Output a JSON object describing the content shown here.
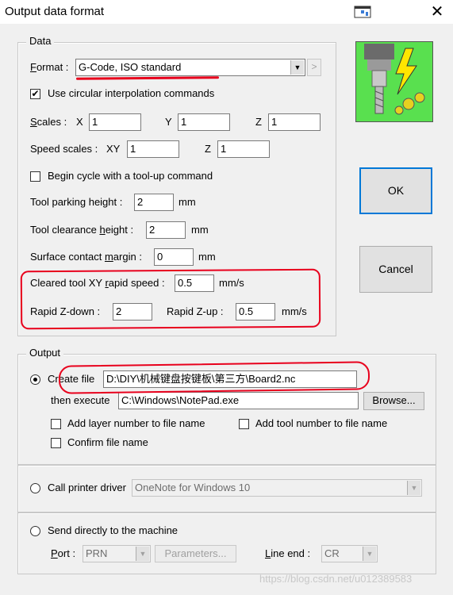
{
  "window": {
    "title": "Output data format",
    "close_glyph": "✕"
  },
  "data_group": {
    "legend": "Data",
    "format_label": "Format :",
    "format_value": "G-Code, ISO standard",
    "format_side_btn": ">",
    "circular_label": "Use circular interpolation commands",
    "circular_checked": true,
    "scales_label": "Scales :",
    "scale_x_label": "X",
    "scale_x": "1",
    "scale_y_label": "Y",
    "scale_y": "1",
    "scale_z_label": "Z",
    "scale_z": "1",
    "speed_scales_label": "Speed scales :",
    "speed_xy_label": "XY",
    "speed_xy": "1",
    "speed_z_label": "Z",
    "speed_z": "1",
    "begin_cycle_label": "Begin cycle with a tool-up command",
    "begin_cycle_checked": false,
    "parking_label": "Tool parking height :",
    "parking_value": "2",
    "parking_unit": "mm",
    "clearance_label": "Tool clearance height :",
    "clearance_value": "2",
    "clearance_unit": "mm",
    "surface_label": "Surface contact margin :",
    "surface_value": "0",
    "surface_unit": "mm",
    "rapid_speed_label": "Cleared tool XY rapid speed :",
    "rapid_speed_value": "0.5",
    "rapid_speed_unit": "mm/s",
    "rapid_zdown_label": "Rapid Z-down :",
    "rapid_zdown_value": "2",
    "rapid_zup_label": "Rapid Z-up :",
    "rapid_zup_value": "0.5",
    "rapid_z_unit": "mm/s"
  },
  "buttons": {
    "ok": "OK",
    "cancel": "Cancel"
  },
  "output_group": {
    "legend": "Output",
    "create_file_label": "Create file",
    "create_file_selected": true,
    "file_path": "D:\\DIY\\机械键盘按键板\\第三方\\Board2.nc",
    "then_execute_label": "then execute",
    "execute_path": "C:\\Windows\\NotePad.exe",
    "browse_label": "Browse...",
    "add_layer_label": "Add layer number to file name",
    "add_tool_label": "Add tool number to file name",
    "confirm_label": "Confirm file name"
  },
  "printer_group": {
    "call_printer_label": "Call printer driver",
    "printer_value": "OneNote for Windows 10"
  },
  "machine_group": {
    "send_label": "Send directly to the machine",
    "port_label": "Port :",
    "port_value": "PRN",
    "parameters_label": "Parameters...",
    "line_end_label": "Line end :",
    "line_end_value": "CR"
  },
  "watermark": "https://blog.csdn.net/u012389583",
  "colors": {
    "annotation_red": "#e8001c",
    "focus_blue": "#0078d7",
    "dialog_bg": "#f0f0f0"
  }
}
